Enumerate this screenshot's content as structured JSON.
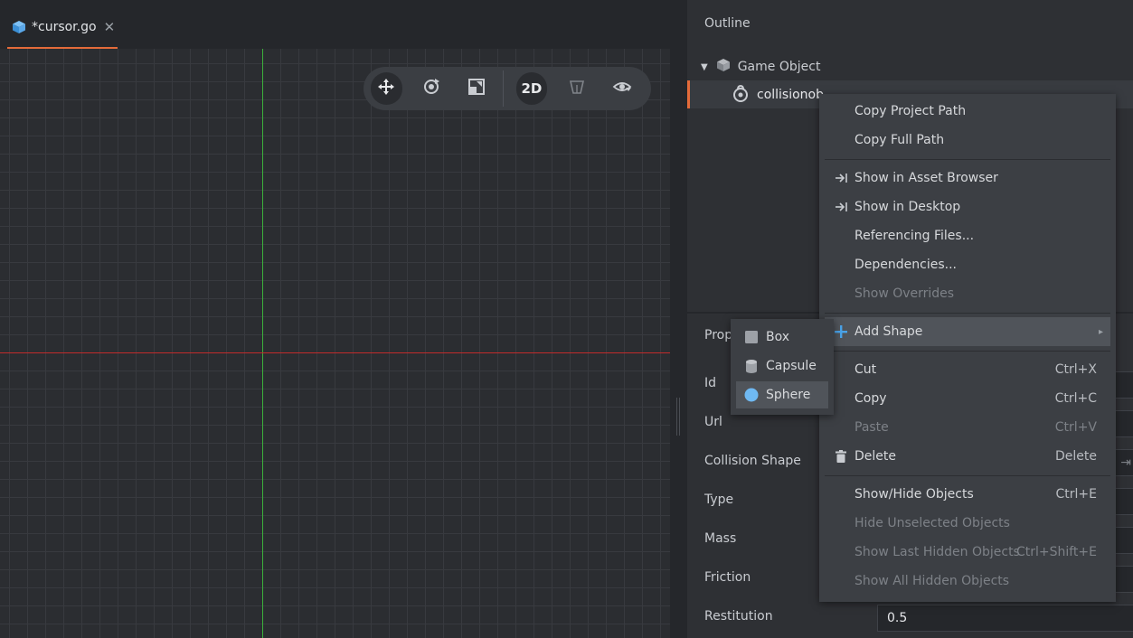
{
  "tab": {
    "label": "*cursor.go",
    "close_glyph": "✕",
    "icon": "cube-icon"
  },
  "toolbar": {
    "mode_label": "2D",
    "tools": [
      "move-tool-icon",
      "rotate-tool-icon",
      "scale-tool-icon",
      "2d-mode-toggle",
      "perspective-camera-icon",
      "visibility-filter-icon"
    ]
  },
  "outline": {
    "title": "Outline",
    "root": {
      "label": "Game Object",
      "icon": "cube-icon"
    },
    "child": {
      "label": "collisionob",
      "icon": "collision-object-icon"
    }
  },
  "properties": {
    "title_partial": "Prop",
    "rows": [
      {
        "label": "Id"
      },
      {
        "label": "Url"
      },
      {
        "label": "Collision Shape"
      },
      {
        "label": "Type"
      },
      {
        "label": "Mass"
      },
      {
        "label": "Friction"
      },
      {
        "label": "Restitution",
        "value": "0.5"
      }
    ]
  },
  "context_menu": {
    "items": [
      {
        "label": "Copy Project Path"
      },
      {
        "label": "Copy Full Path"
      },
      {
        "label": "Show in Asset Browser",
        "icon": "reveal-icon"
      },
      {
        "label": "Show in Desktop",
        "icon": "reveal-icon"
      },
      {
        "label": "Referencing Files..."
      },
      {
        "label": "Dependencies..."
      },
      {
        "label": "Show Overrides",
        "disabled": true
      },
      {
        "label": "Add Shape",
        "icon": "plus-icon",
        "submenu_glyph": "▸"
      },
      {
        "label": "Cut",
        "shortcut": "Ctrl+X"
      },
      {
        "label": "Copy",
        "shortcut": "Ctrl+C"
      },
      {
        "label": "Paste",
        "shortcut": "Ctrl+V",
        "disabled": true
      },
      {
        "label": "Delete",
        "shortcut": "Delete",
        "icon": "trash-icon"
      },
      {
        "label": "Show/Hide Objects",
        "shortcut": "Ctrl+E"
      },
      {
        "label": "Hide Unselected Objects",
        "disabled": true
      },
      {
        "label": "Show Last Hidden Objects",
        "shortcut": "Ctrl+Shift+E",
        "disabled": true
      },
      {
        "label": "Show All Hidden Objects",
        "disabled": true
      }
    ]
  },
  "submenu": {
    "items": [
      {
        "label": "Box",
        "icon": "box-shape-icon"
      },
      {
        "label": "Capsule",
        "icon": "capsule-shape-icon"
      },
      {
        "label": "Sphere",
        "icon": "sphere-shape-icon"
      }
    ]
  },
  "colors": {
    "accent": "#e46b3a",
    "x_axis": "#c12b2b",
    "y_axis": "#3bb03b",
    "plus_icon": "#4aa3e8",
    "sphere_icon": "#6fb9f2"
  }
}
